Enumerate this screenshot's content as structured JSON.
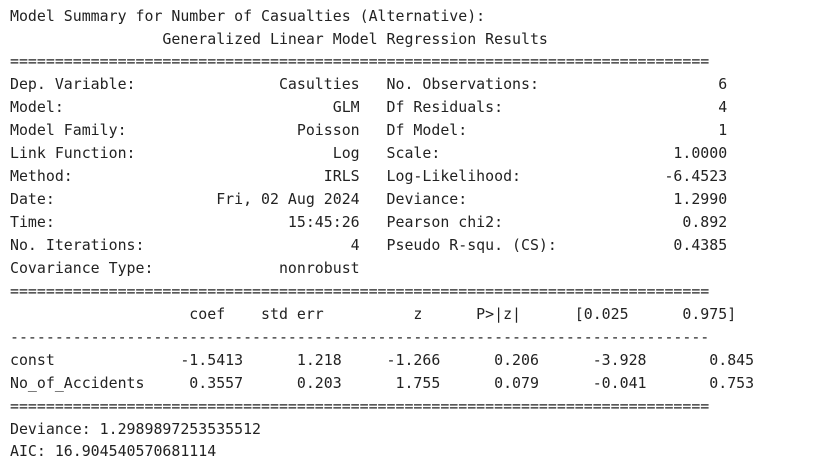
{
  "heading": "Model Summary for Number of Casualties (Alternative):",
  "results_title": "                 Generalized Linear Model Regression Results",
  "separator_double": "==============================================================================",
  "separator_single": "------------------------------------------------------------------------------",
  "info_rows": [
    "Dep. Variable:                Casulties   No. Observations:                    6",
    "Model:                              GLM   Df Residuals:                        4",
    "Model Family:                   Poisson   Df Model:                            1",
    "Link Function:                      Log   Scale:                          1.0000",
    "Method:                            IRLS   Log-Likelihood:                -6.4523",
    "Date:                  Fri, 02 Aug 2024   Deviance:                       1.2990",
    "Time:                          15:45:26   Pearson chi2:                    0.892",
    "No. Iterations:                       4   Pseudo R-squ. (CS):             0.4385",
    "Covariance Type:              nonrobust"
  ],
  "coef_header": "                    coef    std err          z      P>|z|      [0.025      0.975]",
  "coef_rows": [
    "const              -1.5413      1.218     -1.266      0.206      -3.928       0.845",
    "No_of_Accidents     0.3557      0.203      1.755      0.079      -0.041       0.753"
  ],
  "deviance_line": "Deviance: 1.2989897253535512",
  "aic_line": "AIC: 16.904540570681114"
}
